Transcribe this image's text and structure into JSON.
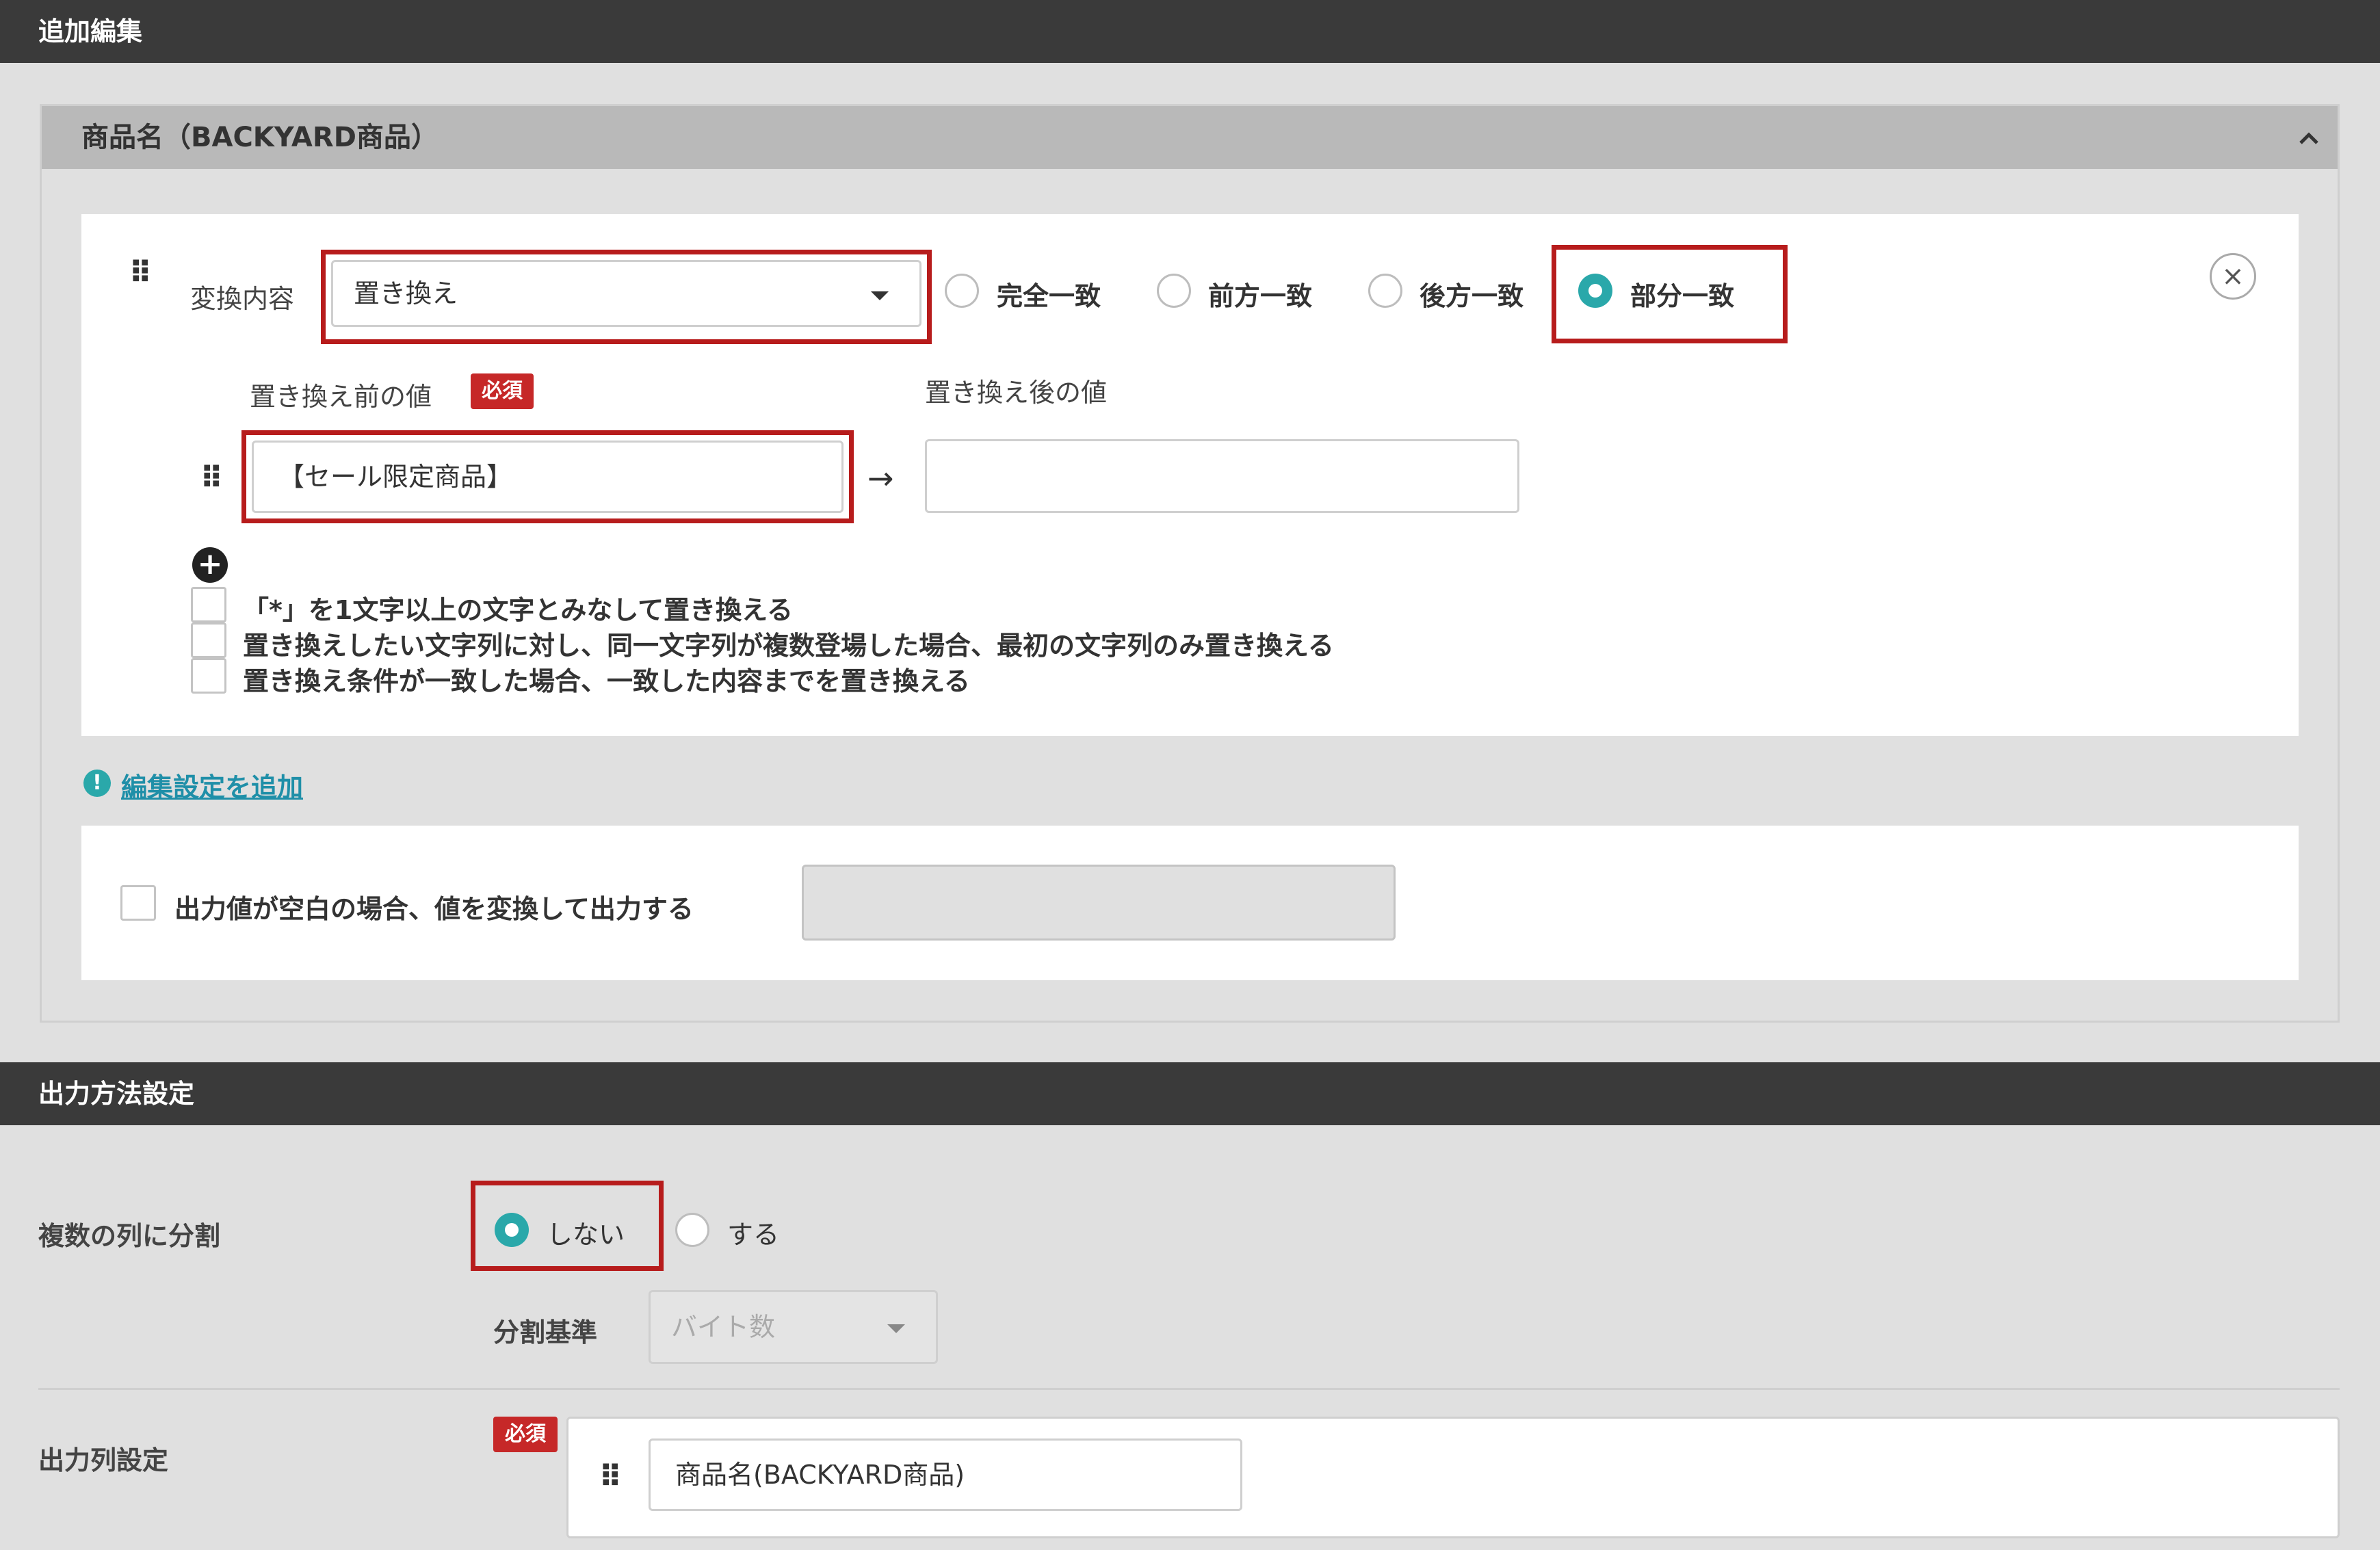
{
  "sections": {
    "additional_edit": "追加編集",
    "output_method": "出力方法設定"
  },
  "accordion": {
    "title": "商品名（BACKYARD商品）",
    "chevron": "⌃"
  },
  "rule": {
    "conversion_label": "変換内容",
    "conversion_value": "置き換え",
    "match_options": [
      {
        "label": "完全一致",
        "selected": false
      },
      {
        "label": "前方一致",
        "selected": false
      },
      {
        "label": "後方一致",
        "selected": false
      },
      {
        "label": "部分一致",
        "selected": true
      }
    ],
    "before_label": "置き換え前の値",
    "required_badge": "必須",
    "after_label": "置き換え後の値",
    "before_value": "【セール限定商品】",
    "after_value": "",
    "arrow": "→",
    "add_icon": "+",
    "close_icon": "×",
    "checkboxes": [
      {
        "label": "「*」を1文字以上の文字とみなして置き換える",
        "checked": false
      },
      {
        "label": "置き換えしたい文字列に対し、同一文字列が複数登場した場合、最初の文字列のみ置き換える",
        "checked": false
      },
      {
        "label": "置き換え条件が一致した場合、一致した内容までを置き換える",
        "checked": false
      }
    ]
  },
  "add_edit_link": "編集設定を追加",
  "info_icon": "!",
  "blank_output": {
    "label": "出力値が空白の場合、値を変換して出力する",
    "checked": false,
    "value": ""
  },
  "split": {
    "label": "複数の列に分割",
    "options": [
      {
        "label": "しない",
        "selected": true
      },
      {
        "label": "する",
        "selected": false
      }
    ],
    "criteria_label": "分割基準",
    "criteria_value": "バイト数"
  },
  "output_columns": {
    "label": "出力列設定",
    "required_badge": "必須",
    "value": "商品名(BACKYARD商品)"
  },
  "colors": {
    "accent": "#2aa8aa",
    "highlight_red": "#b71c1c",
    "badge_red": "#c62828",
    "header_dark": "#3a3a3a"
  }
}
